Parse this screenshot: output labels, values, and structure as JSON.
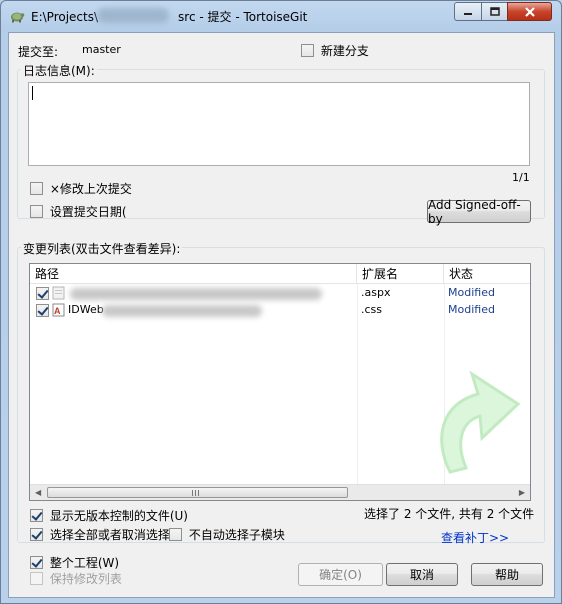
{
  "window": {
    "title_part1": "E:\\Projects\\",
    "title_part2": "src - 提交 - TortoiseGit",
    "colors": {
      "close_button": "#c9442b",
      "link": "#0033cc",
      "status": "#1b3f8b"
    }
  },
  "header": {
    "commit_to_label": "提交至:",
    "branch": "master",
    "new_branch_label": "新建分支"
  },
  "message": {
    "label": "日志信息(M):",
    "value": "",
    "counter": "1/1"
  },
  "options": {
    "amend_label": "×修改上次提交",
    "set_date_label": "设置提交日期(",
    "signed_off_button": "Add Signed-off-by"
  },
  "changes": {
    "group_label": "变更列表(双击文件查看差异):",
    "columns": [
      "路径",
      "扩展名",
      "状态"
    ],
    "rows": [
      {
        "path": "",
        "ext": ".aspx",
        "status": "Modified",
        "checked": true,
        "icon": "aspx-file-icon"
      },
      {
        "path": "IDWeb",
        "ext": ".css",
        "status": "Modified",
        "checked": true,
        "icon": "css-file-icon"
      }
    ],
    "show_unversioned_label": "显示无版本控制的文件(U)",
    "select_all_label": "选择全部或者取消选择",
    "no_auto_submodule_label": "不自动选择子模块",
    "selection_summary": "选择了 2 个文件, 共有 2 个文件",
    "view_patch_link": "查看补丁>>"
  },
  "footer": {
    "whole_project_label": "整个工程(W)",
    "keep_list_label": "保持修改列表",
    "ok_button": "确定(O)",
    "cancel_button": "取消",
    "help_button": "帮助"
  }
}
